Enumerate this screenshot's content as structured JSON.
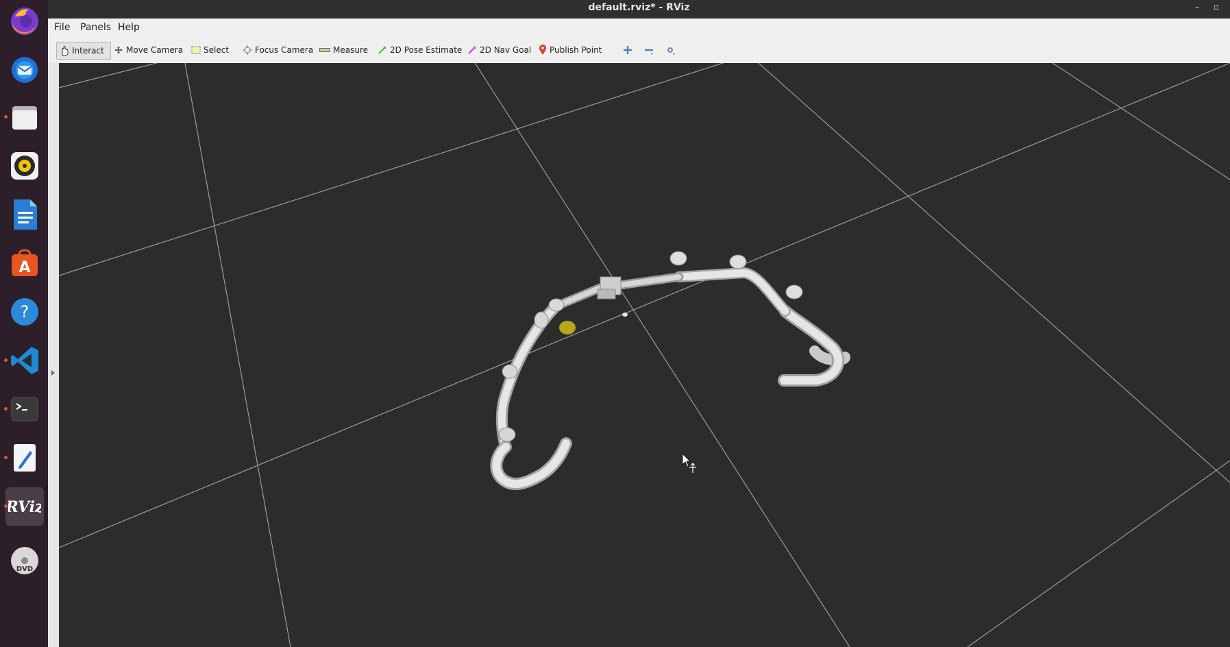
{
  "window": {
    "title": "default.rviz* - RViz",
    "minimize_symbol": "–",
    "restore_symbol": "▫"
  },
  "menubar": {
    "file": "File",
    "panels": "Panels",
    "help": "Help"
  },
  "toolbar": {
    "interact": "Interact",
    "move_camera": "Move Camera",
    "select": "Select",
    "focus_camera": "Focus Camera",
    "measure": "Measure",
    "pose_estimate": "2D Pose Estimate",
    "nav_goal": "2D Nav Goal",
    "publish_point": "Publish Point"
  },
  "dock": {
    "items": [
      {
        "icon": "firefox-icon",
        "running": false
      },
      {
        "icon": "thunderbird-icon",
        "running": false
      },
      {
        "icon": "files-icon",
        "running": true
      },
      {
        "icon": "rhythmbox-icon",
        "running": false
      },
      {
        "icon": "libreoffice-writer-icon",
        "running": false
      },
      {
        "icon": "app-center-icon",
        "running": false
      },
      {
        "icon": "help-icon",
        "running": false
      },
      {
        "icon": "vscode-icon",
        "running": true
      },
      {
        "icon": "terminal-icon",
        "running": true
      },
      {
        "icon": "text-editor-icon",
        "running": true
      },
      {
        "icon": "rviz-icon",
        "running": true,
        "active": true,
        "label": "RViz"
      },
      {
        "icon": "dvd-icon",
        "running": false,
        "label": "DVD"
      }
    ]
  },
  "viewport": {
    "background": "#2c2c2c",
    "grid_color": "#a0a0a0",
    "marker_color": "#b8a61c"
  }
}
